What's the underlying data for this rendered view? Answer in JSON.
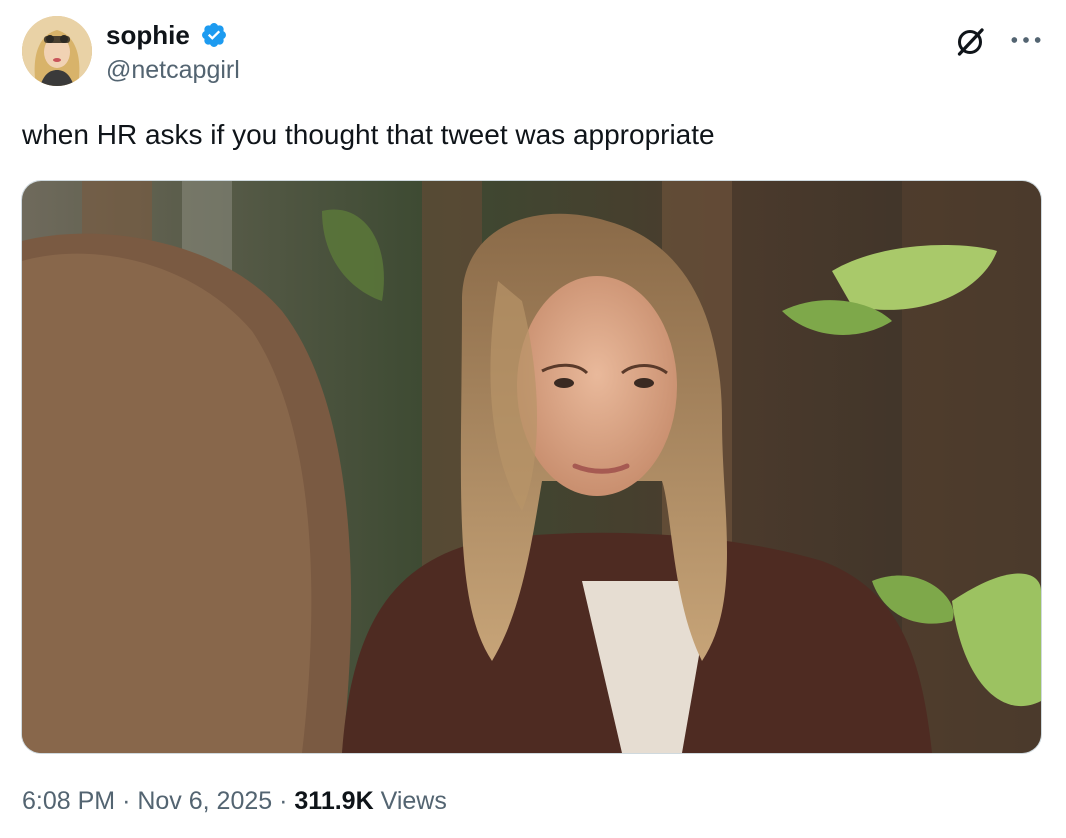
{
  "author": {
    "display_name": "sophie",
    "handle": "@netcapgirl",
    "verified": true,
    "avatar_icon": "profile-photo",
    "verified_icon": "verified-badge-icon",
    "verified_color": "#1d9bf0"
  },
  "tweet": {
    "text": "when HR asks if you thought that tweet was appropriate",
    "media_icon": "attached-photo"
  },
  "meta": {
    "time": "6:08 PM",
    "separator": "·",
    "date": "Nov 6, 2025",
    "views_count": "311.9K",
    "views_label": "Views"
  },
  "actions": {
    "grok_icon": "grok-icon",
    "more_icon": "more-options-icon"
  },
  "colors": {
    "text": "#0f1419",
    "secondary": "#536471",
    "background": "#ffffff"
  }
}
